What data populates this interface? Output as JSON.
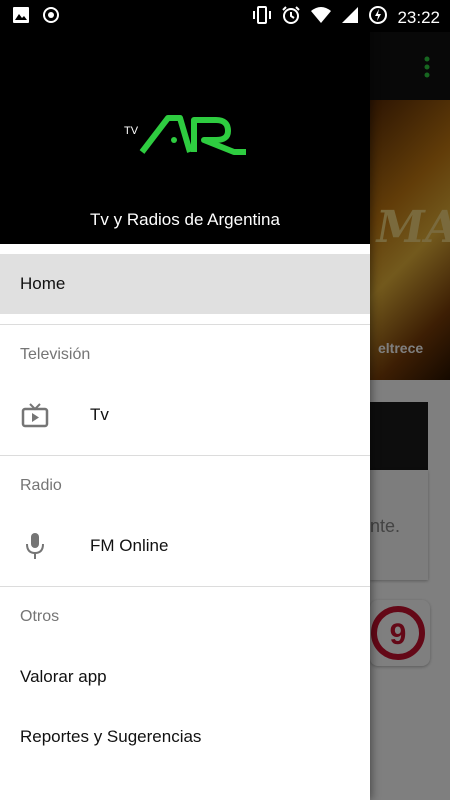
{
  "status_bar": {
    "time": "23:22",
    "left_icons": [
      "image-notification-icon",
      "record-notification-icon"
    ],
    "right_icons": [
      "vibrate-icon",
      "alarm-icon",
      "wifi-icon",
      "signal-icon",
      "battery-charging-icon"
    ]
  },
  "drawer": {
    "app_title": "Tv y Radios de Argentina",
    "logo_small": "TV",
    "logo_main": "AR",
    "home_label": "Home",
    "sections": {
      "tv_label": "Televisión",
      "tv_item": "Tv",
      "radio_label": "Radio",
      "radio_item": "FM Online",
      "others_label": "Otros",
      "rate_item": "Valorar app",
      "reports_item": "Reportes y Sugerencias"
    }
  },
  "background": {
    "banner_text": "MA",
    "banner_sub": "eltrece",
    "card_text": "nte.",
    "channel_number": "9"
  },
  "colors": {
    "accent_green": "#2ecc40",
    "drawer_header": "#000000",
    "selected_item": "#e0e0e0"
  }
}
